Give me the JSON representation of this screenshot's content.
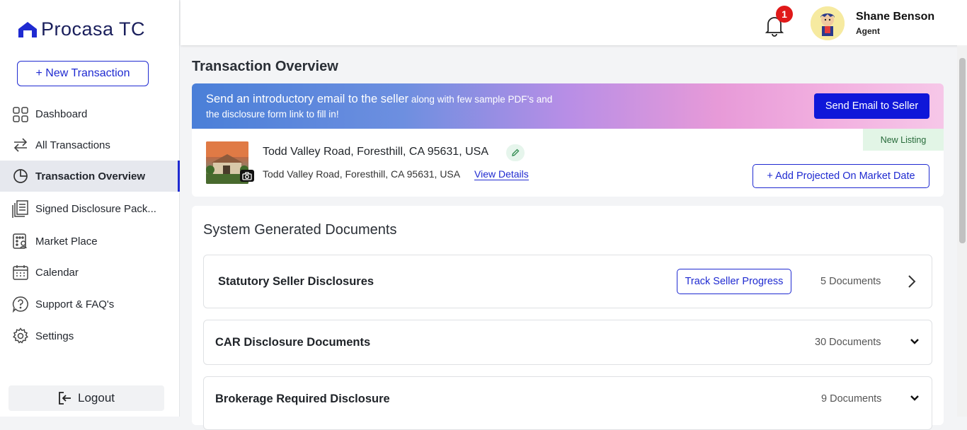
{
  "app": {
    "brand": "Procasa TC"
  },
  "sidebar": {
    "new_transaction": "+ New Transaction",
    "items": [
      {
        "label": "Dashboard",
        "icon": "grid-icon"
      },
      {
        "label": "All Transactions",
        "icon": "transfer-arrows-icon"
      },
      {
        "label": "Transaction Overview",
        "icon": "pie-chart-icon",
        "active": true
      },
      {
        "label": "Signed Disclosure Pack...",
        "icon": "documents-stack-icon"
      },
      {
        "label": "Market Place",
        "icon": "marketplace-icon"
      },
      {
        "label": "Calendar",
        "icon": "calendar-icon"
      },
      {
        "label": "Support & FAQ's",
        "icon": "help-bubble-icon"
      },
      {
        "label": "Settings",
        "icon": "gear-icon"
      }
    ],
    "logout": "Logout"
  },
  "header": {
    "notification_count": "1",
    "user_name": "Shane Benson",
    "user_role": "Agent"
  },
  "page": {
    "title": "Transaction Overview",
    "banner": {
      "text_big": "Send an introductory email to the seller",
      "text_small_1": " along with few sample PDF’s and",
      "text_small_2": "the disclosure form link to fill in!",
      "button": "Send Email to Seller"
    },
    "property": {
      "address_title": "Todd Valley Road, Foresthill, CA 95631, USA",
      "address_sub": "Todd Valley Road, Foresthill, CA 95631, USA",
      "view_details": "View Details",
      "status_badge": "New Listing",
      "add_projected": "+ Add Projected On Market Date"
    },
    "documents": {
      "section_title": "System Generated Documents",
      "groups": [
        {
          "name": "Statutory Seller Disclosures",
          "count": "5 Documents",
          "action": "Track Seller Progress"
        },
        {
          "name": "CAR Disclosure Documents",
          "count": "30 Documents"
        },
        {
          "name": "Brokerage Required Disclosure",
          "count": "9 Documents"
        }
      ]
    }
  },
  "colors": {
    "accent": "#1f2ad1",
    "badge": "#e01919",
    "status_green_bg": "#e2f5e6"
  }
}
